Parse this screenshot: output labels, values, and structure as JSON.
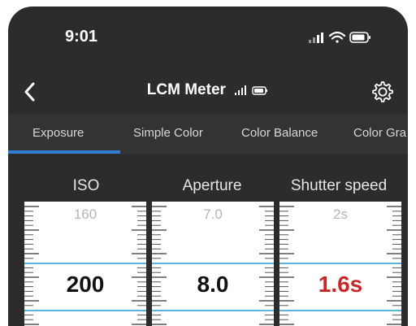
{
  "status_bar": {
    "time": "9:01",
    "icons": [
      "cellular-signal-icon",
      "wifi-icon",
      "battery-icon"
    ]
  },
  "nav": {
    "title": "LCM Meter",
    "title_icons": [
      "signal-bars-icon",
      "battery-icon"
    ],
    "back_icon": "chevron-left-icon",
    "settings_icon": "gear-icon"
  },
  "tabs": [
    {
      "label": "Exposure",
      "active": true
    },
    {
      "label": "Simple Color",
      "active": false
    },
    {
      "label": "Color Balance",
      "active": false
    },
    {
      "label": "Color Gra",
      "active": false
    }
  ],
  "meters": [
    {
      "label": "ISO",
      "prev_value": "160",
      "value": "200",
      "value_color": "#111111"
    },
    {
      "label": "Aperture",
      "prev_value": "7.0",
      "value": "8.0",
      "value_color": "#111111"
    },
    {
      "label": "Shutter speed",
      "prev_value": "2s",
      "value": "1.6s",
      "value_color": "#c62828"
    }
  ],
  "colors": {
    "accent": "#2f7fd2",
    "background": "#2c2c2c",
    "selection_line": "#5bb4d8",
    "highlight_value": "#c62828"
  }
}
